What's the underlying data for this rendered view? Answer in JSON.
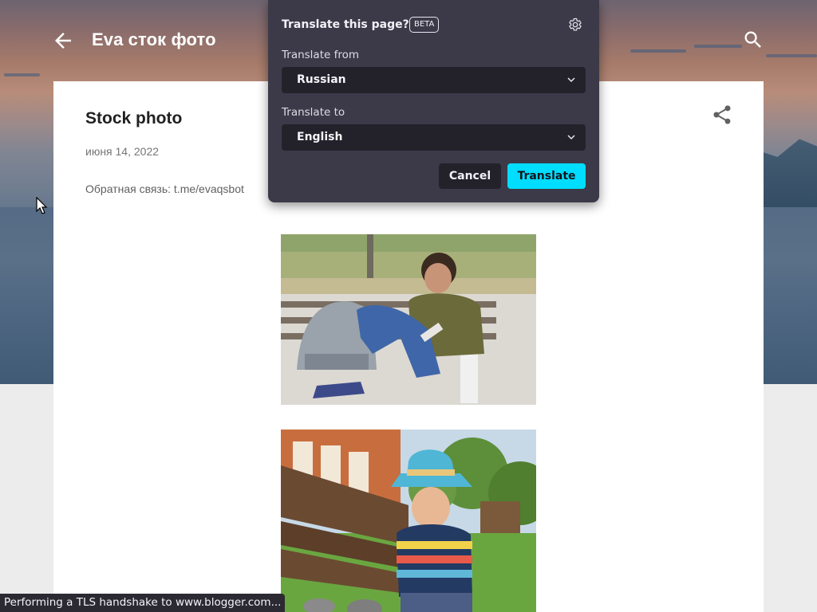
{
  "blog": {
    "title": "Eva сток фото"
  },
  "post": {
    "title": "Stock photo",
    "date": "июня 14, 2022",
    "feedback": "Обратная связь: t.me/evaqsbot"
  },
  "translate_popup": {
    "title": "Translate this page?",
    "badge": "BETA",
    "from_label": "Translate from",
    "from_value": "Russian",
    "to_label": "Translate to",
    "to_value": "English",
    "cancel_label": "Cancel",
    "translate_label": "Translate",
    "accent_color": "#00ddff"
  },
  "status_bar": {
    "text": "Performing a TLS handshake to www.blogger.com..."
  },
  "icons": {
    "back": "arrow-left-icon",
    "search": "search-icon",
    "share": "share-icon",
    "settings": "gear-icon",
    "dropdown": "chevron-down-icon"
  }
}
